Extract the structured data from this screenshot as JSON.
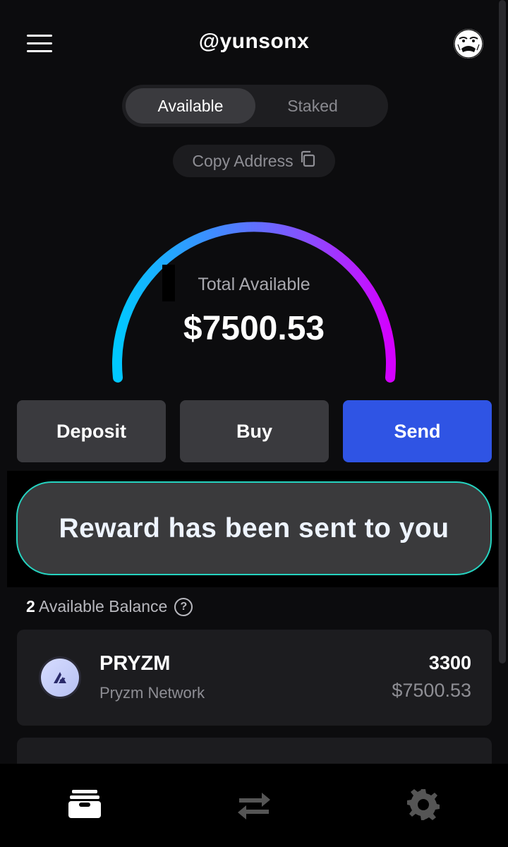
{
  "header": {
    "username": "@yunsonx",
    "menu_icon": "hamburger-menu-icon",
    "avatar_icon": "user-avatar-icon"
  },
  "tabs": {
    "available": "Available",
    "staked": "Staked",
    "selected": "Available"
  },
  "copy_address": {
    "label": "Copy Address",
    "icon": "copy-icon"
  },
  "gauge": {
    "label": "Total Available",
    "value": "$7500.53",
    "gradient_colors": [
      "#00c8ff",
      "#3f8cff",
      "#8a4dff",
      "#d400ff"
    ]
  },
  "actions": {
    "deposit": "Deposit",
    "buy": "Buy",
    "send": "Send"
  },
  "toast": {
    "message": "Reward has been sent to you"
  },
  "balances": {
    "count": "2",
    "label": "Available Balance",
    "help_icon": "question-circle-icon",
    "help_glyph": "?",
    "items": [
      {
        "symbol": "PRYZM",
        "network": "Pryzm Network",
        "amount": "3300",
        "value": "$7500.53",
        "icon": "pryzm-logo-icon"
      }
    ]
  },
  "bottom_nav": {
    "items": [
      {
        "icon": "wallet-icon",
        "active": true
      },
      {
        "icon": "swap-arrows-icon",
        "active": false
      },
      {
        "icon": "gear-icon",
        "active": false
      }
    ]
  },
  "colors": {
    "accent_blue": "#2f54e4",
    "toast_border": "#25d3c0",
    "background": "#0c0c0e"
  }
}
